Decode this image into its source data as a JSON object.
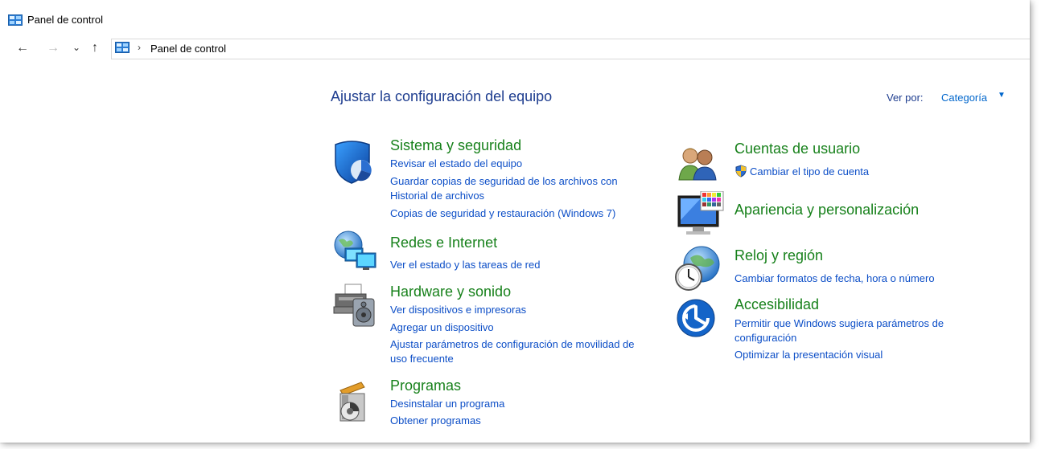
{
  "window": {
    "title": "Panel de control"
  },
  "nav": {
    "back": "←",
    "forward": "→",
    "recent": "⌄",
    "up": "↑",
    "separator": "›",
    "breadcrumb": "Panel de control"
  },
  "main": {
    "heading": "Ajustar la configuración del equipo",
    "view_by_label": "Ver por:",
    "view_by_value": "Categoría",
    "view_by_arrow": "▼"
  },
  "categories": {
    "system": {
      "icon": "shield-icon",
      "title": "Sistema y seguridad",
      "links": [
        "Revisar el estado del equipo",
        "Guardar copias de seguridad de los archivos con",
        "Historial de archivos",
        "Copias de seguridad y restauración (Windows 7)"
      ]
    },
    "network": {
      "icon": "network-globe-icon",
      "title": "Redes e Internet",
      "links": [
        "Ver el estado y las tareas de red"
      ]
    },
    "hardware": {
      "icon": "printer-icon",
      "title": "Hardware y sonido",
      "links": [
        "Ver dispositivos e impresoras",
        "Agregar un dispositivo",
        "Ajustar parámetros de configuración de movilidad de",
        "uso frecuente"
      ]
    },
    "programs": {
      "icon": "programs-icon",
      "title": "Programas",
      "links": [
        "Desinstalar un programa",
        "Obtener programas"
      ]
    },
    "accounts": {
      "icon": "users-icon",
      "title": "Cuentas de usuario",
      "links": [
        "Cambiar el tipo de cuenta"
      ]
    },
    "appearance": {
      "icon": "monitor-palette-icon",
      "title": "Apariencia y personalización",
      "links": []
    },
    "clock": {
      "icon": "clock-globe-icon",
      "title": "Reloj y región",
      "links": [
        "Cambiar formatos de fecha, hora o número"
      ]
    },
    "access": {
      "icon": "accessibility-icon",
      "title": "Accesibilidad",
      "links": [
        "Permitir que Windows sugiera parámetros de",
        "configuración",
        "Optimizar la presentación visual"
      ]
    }
  },
  "colors": {
    "heading": "#1e3d8f",
    "category": "#17811b",
    "link": "#0c4ec7"
  }
}
